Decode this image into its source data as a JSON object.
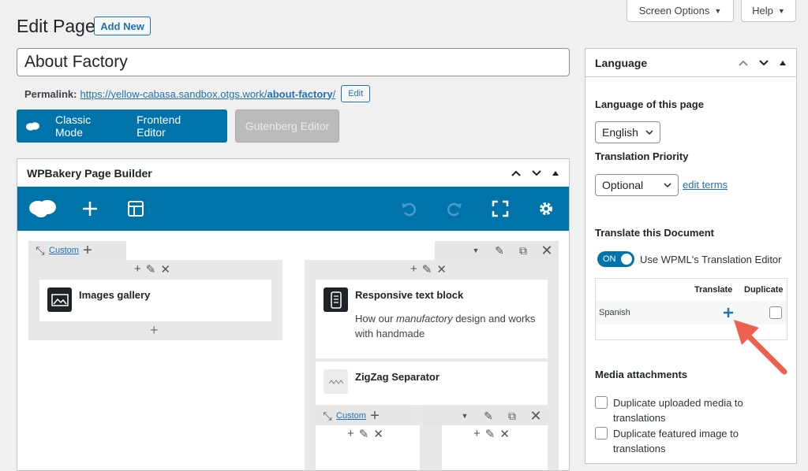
{
  "top_tabs": {
    "screen_options": "Screen Options",
    "help": "Help"
  },
  "header": {
    "title": "Edit Page",
    "add_new": "Add New"
  },
  "post": {
    "title": "About Factory",
    "permalink_label": "Permalink:",
    "permalink_base": "https://yellow-cabasa.sandbox.otgs.work/",
    "permalink_slug": "about-factory",
    "permalink_trail": "/",
    "edit_label": "Edit"
  },
  "modes": {
    "classic": "Classic Mode",
    "frontend": "Frontend Editor",
    "gutenberg": "Gutenberg Editor"
  },
  "wpbakery": {
    "title": "WPBakery Page Builder",
    "row1": {
      "custom": "Custom"
    },
    "row2": {
      "custom": "Custom"
    },
    "elements": {
      "gallery": {
        "title": "Images gallery"
      },
      "text_block": {
        "title": "Responsive text block",
        "desc_pre": "How our ",
        "desc_em": "manufactory",
        "desc_post": " design and works with handmade"
      },
      "zigzag": {
        "title": "ZigZag Separator"
      }
    }
  },
  "language_box": {
    "title": "Language",
    "lang_of_page_label": "Language of this page",
    "language_value": "English",
    "priority_label": "Translation Priority",
    "priority_value": "Optional",
    "edit_terms": "edit terms",
    "translate_doc_label": "Translate this Document",
    "toggle_state": "ON",
    "toggle_label": "Use WPML's Translation Editor",
    "table": {
      "col_translate": "Translate",
      "col_duplicate": "Duplicate",
      "rows": [
        {
          "language": "Spanish"
        }
      ]
    },
    "media_label": "Media attachments",
    "dup_uploaded": "Duplicate uploaded media to translations",
    "dup_featured": "Duplicate featured image to translations"
  },
  "colors": {
    "accent": "#0073aa",
    "link": "#2271b1",
    "arrow": "#f0604e"
  }
}
